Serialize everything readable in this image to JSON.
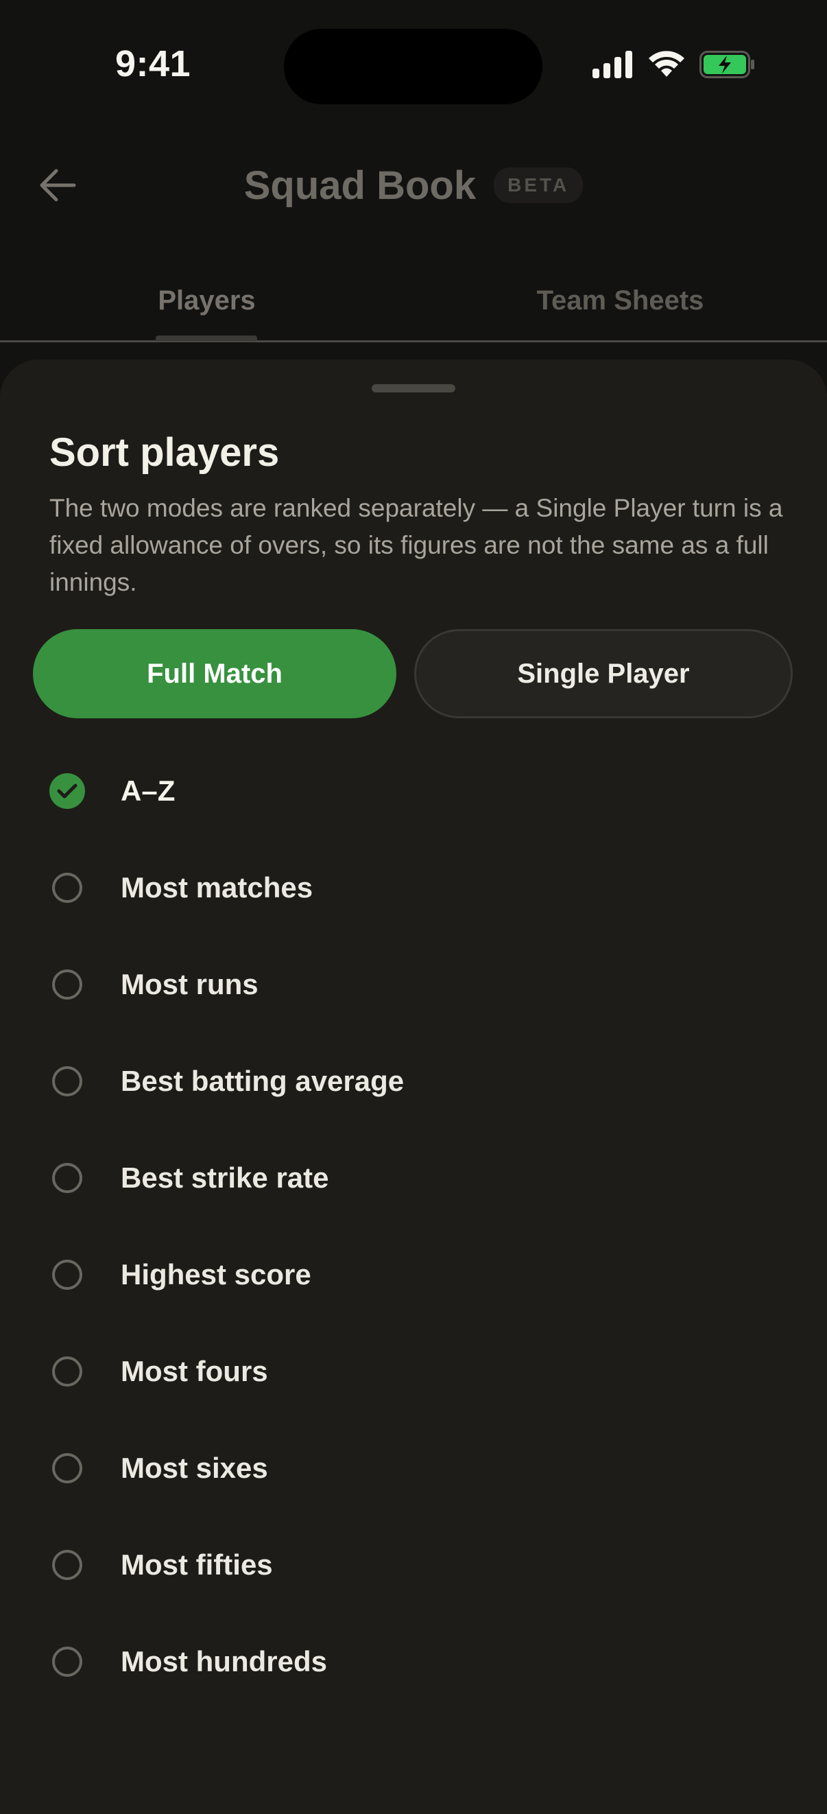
{
  "status_bar": {
    "time": "9:41",
    "icons": [
      "cellular-signal-icon",
      "wifi-icon",
      "battery-charging-icon"
    ],
    "battery_color": "#34c759"
  },
  "header": {
    "back_icon": "arrow-left-icon",
    "title": "Squad Book",
    "badge": "BETA"
  },
  "tabs": [
    {
      "label": "Players",
      "active": true
    },
    {
      "label": "Team Sheets",
      "active": false
    }
  ],
  "sheet": {
    "title": "Sort players",
    "description": "The two modes are ranked separately — a Single Player turn is a fixed allowance of overs, so its figures are not the same as a full innings.",
    "modes": [
      {
        "label": "Full Match",
        "selected": true
      },
      {
        "label": "Single Player",
        "selected": false
      }
    ],
    "options": [
      {
        "label": "A–Z",
        "selected": true
      },
      {
        "label": "Most matches",
        "selected": false
      },
      {
        "label": "Most runs",
        "selected": false
      },
      {
        "label": "Best batting average",
        "selected": false
      },
      {
        "label": "Best strike rate",
        "selected": false
      },
      {
        "label": "Highest score",
        "selected": false
      },
      {
        "label": "Most fours",
        "selected": false
      },
      {
        "label": "Most sixes",
        "selected": false
      },
      {
        "label": "Most fifties",
        "selected": false
      },
      {
        "label": "Most hundreds",
        "selected": false
      }
    ],
    "accent_color": "#37913f"
  }
}
